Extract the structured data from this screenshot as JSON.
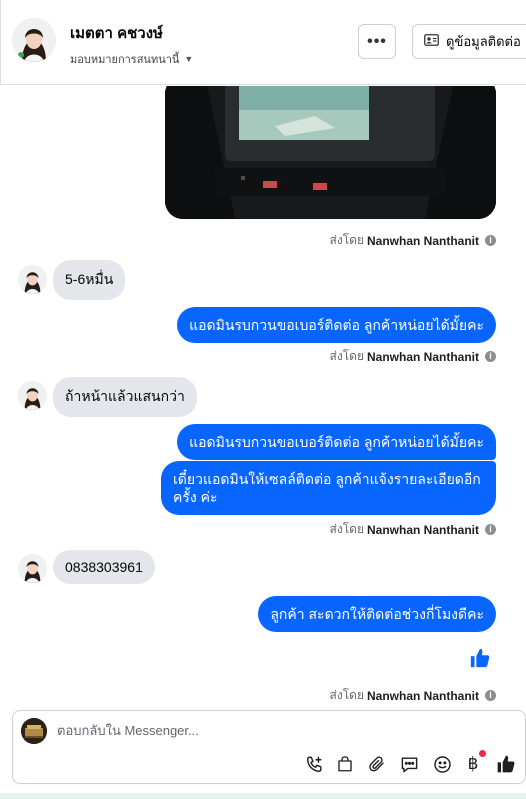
{
  "header": {
    "contact_name": "เมตตา คชวงษ์",
    "assign_label": "มอบหมายการสนทนานี้",
    "more_label": "•••",
    "contact_info_label": "ดูข้อมูลติดต่อ"
  },
  "messages": [
    {
      "side": "in",
      "text": "5-6หมื่น"
    },
    {
      "side": "out",
      "text": "แอดมินรบกวนขอเบอร์ติดต่อ ลูกค้าหน่อยได้มั้ยคะ"
    },
    {
      "side": "in",
      "text": "ถ้าหน้าแล้วแสนกว่า"
    },
    {
      "side": "out",
      "text": "แอดมินรบกวนขอเบอร์ติดต่อ ลูกค้าหน่อยได้มั้ยคะ"
    },
    {
      "side": "out",
      "text": "เดี๋ยวแอดมินให้เซลล์ติดต่อ ลูกค้าแจ้งรายละเอียดอีก ครั้ง ค่ะ"
    },
    {
      "side": "in",
      "text": "0838303961"
    },
    {
      "side": "out",
      "text": "ลูกค้า สะดวกให้ติดต่อช่วงกี่โมงดีคะ"
    }
  ],
  "sent_by": {
    "prefix": "ส่งโดย",
    "name": "Nanwhan Nanthanit"
  },
  "composer": {
    "placeholder": "ตอบกลับใน Messenger..."
  },
  "colors": {
    "outgoing_bubble": "#0866ff",
    "incoming_bubble": "#e4e6eb",
    "accent": "#0866ff"
  },
  "icons": [
    "call-add-icon",
    "shopping-bag-icon",
    "paperclip-icon",
    "saved-reply-icon",
    "emoji-icon",
    "baht-icon",
    "thumbs-up-icon",
    "info-icon"
  ]
}
